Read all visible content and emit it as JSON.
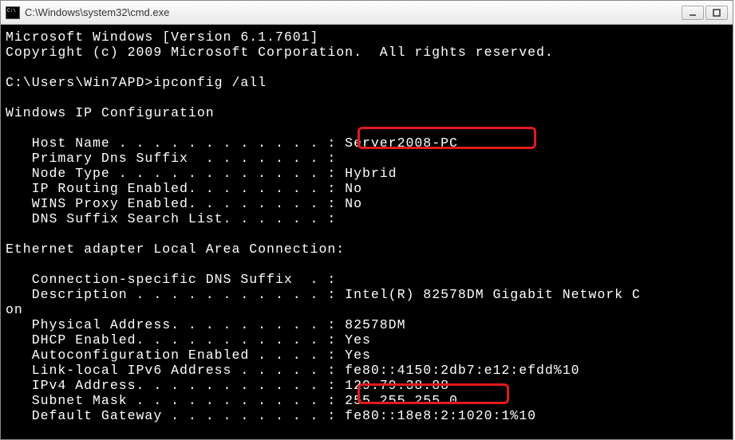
{
  "window": {
    "title": "C:\\Windows\\system32\\cmd.exe"
  },
  "banner": {
    "line1": "Microsoft Windows [Version 6.1.7601]",
    "line2": "Copyright (c) 2009 Microsoft Corporation.  All rights reserved."
  },
  "prompt": {
    "line": "C:\\Users\\Win7APD>ipconfig /all"
  },
  "sections": {
    "winIpConfig": "Windows IP Configuration",
    "fields": {
      "hostName": {
        "label": "   Host Name . . . . . . . . . . . . : ",
        "value": "Server2008-PC"
      },
      "primaryDns": {
        "label": "   Primary Dns Suffix  . . . . . . . :",
        "value": ""
      },
      "nodeType": {
        "label": "   Node Type . . . . . . . . . . . . : ",
        "value": "Hybrid"
      },
      "ipRouting": {
        "label": "   IP Routing Enabled. . . . . . . . : ",
        "value": "No"
      },
      "winsProxy": {
        "label": "   WINS Proxy Enabled. . . . . . . . : ",
        "value": "No"
      },
      "dnsSuffix": {
        "label": "   DNS Suffix Search List. . . . . . :",
        "value": ""
      }
    },
    "adapterHeader": "Ethernet adapter Local Area Connection:",
    "adapter": {
      "connSuffix": {
        "label": "   Connection-specific DNS Suffix  . :",
        "value": ""
      },
      "description": {
        "label": "   Description . . . . . . . . . . . : ",
        "value": "Intel(R) 82578DM Gigabit Network C"
      },
      "descWrap": {
        "label": "on",
        "value": ""
      },
      "physAddr": {
        "label": "   Physical Address. . . . . . . . . : ",
        "value": "82578DM"
      },
      "dhcp": {
        "label": "   DHCP Enabled. . . . . . . . . . . : ",
        "value": "Yes"
      },
      "autoconfig": {
        "label": "   Autoconfiguration Enabled . . . . : ",
        "value": "Yes"
      },
      "linkLocal": {
        "label": "   Link-local IPv6 Address . . . . . : ",
        "value": "fe80::4150:2db7:e12:efdd%10"
      },
      "ipv4": {
        "label": "   IPv4 Address. . . . . . . . . . . : ",
        "value": "129.79.38.88"
      },
      "subnet": {
        "label": "   Subnet Mask . . . . . . . . . . . : ",
        "value": "255.255.255.0"
      },
      "gateway": {
        "label": "   Default Gateway . . . . . . . . . : ",
        "value": "fe80::18e8:2:1020:1%10"
      }
    }
  },
  "icons": {
    "cmd": "cmd-icon",
    "minimize": "minimize-icon",
    "maximize": "maximize-icon"
  }
}
